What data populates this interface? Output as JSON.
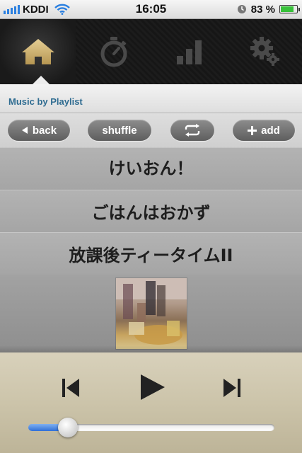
{
  "status_bar": {
    "carrier": "KDDI",
    "time": "16:05",
    "battery_percent": "83 %",
    "battery_level": 0.83,
    "icons": [
      "signal-icon",
      "wifi-icon",
      "clock-icon",
      "battery-icon"
    ]
  },
  "tab_bar": {
    "tabs": [
      {
        "icon": "home-icon",
        "active": true
      },
      {
        "icon": "stopwatch-icon",
        "active": false
      },
      {
        "icon": "bar-chart-icon",
        "active": false
      },
      {
        "icon": "gear-icon",
        "active": false
      }
    ]
  },
  "header": {
    "title": "Music by Playlist"
  },
  "toolbar": {
    "back_label": "back",
    "shuffle_label": "shuffle",
    "add_label": "add"
  },
  "list": {
    "items": [
      {
        "title": "けいおん！"
      },
      {
        "title": "ごはんはおかず"
      },
      {
        "title": "放課後ティータイムII"
      }
    ]
  },
  "player": {
    "progress": 0.15
  },
  "colors": {
    "header_title": "#2f6c91",
    "progress_fill": "#2f6fd8",
    "battery": "#38c13a",
    "signal": "#2a7fe0"
  }
}
